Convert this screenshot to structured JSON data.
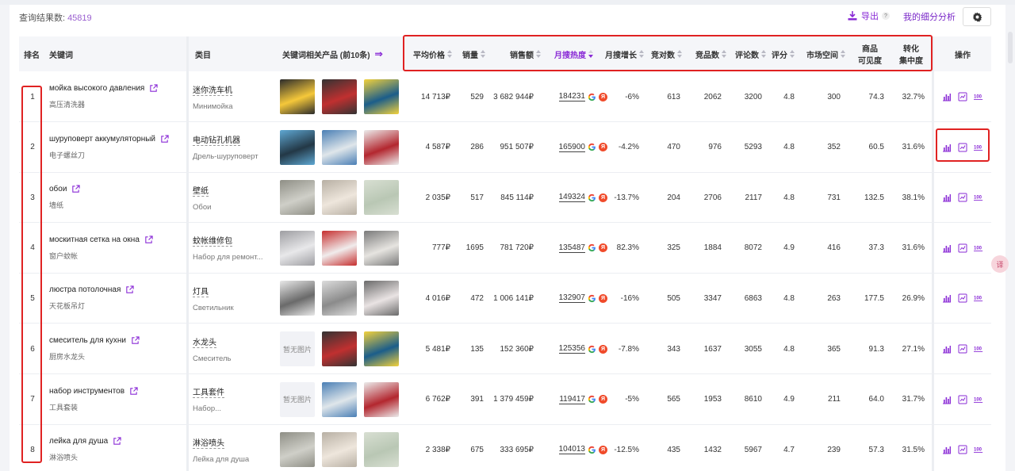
{
  "summary": {
    "label": "查询结果数:",
    "count": "45819"
  },
  "toolbar": {
    "export_label": "导出",
    "help_label": "?",
    "my_analysis_label": "我的细分分析"
  },
  "colors": {
    "accent": "#8a2bd6",
    "highlight_box": "#e02222"
  },
  "table": {
    "headers": {
      "rank": "排名",
      "keyword": "关键词",
      "category": "类目",
      "products": "关键词相关产品 (前10条)",
      "products_more": "⇒",
      "avg_price": "平均价格",
      "sales": "销量",
      "revenue": "销售额",
      "monthly_heat": "月搜热度",
      "monthly_growth": "月搜增长",
      "competition": "竞对数",
      "product_count": "竞品数",
      "reviews": "评论数",
      "rating": "评分",
      "market_space": "市场空间",
      "visibility_1": "商品",
      "visibility_2": "可见度",
      "conversion_1": "转化",
      "conversion_2": "集中度",
      "actions": "操作"
    },
    "rows": [
      {
        "rank": "1",
        "kw_ru": "мойка высокого давления",
        "kw_zh": "高压清洗器",
        "cat_zh": "迷你洗车机",
        "cat_ru": "Минимойка",
        "thumbs": [
          "img",
          "img",
          "img"
        ],
        "price": "14 713₽",
        "sales": "529",
        "revenue": "3 682 944₽",
        "heat": "184231",
        "growth": "-6%",
        "competition": "613",
        "products": "2062",
        "reviews": "3200",
        "rating": "4.8",
        "market": "300",
        "visibility": "74.3",
        "conversion": "32.7%"
      },
      {
        "rank": "2",
        "kw_ru": "шуруповерт аккумуляторный",
        "kw_zh": "电子螺丝刀",
        "cat_zh": "电动钻孔机器",
        "cat_ru": "Дрель-шуруповерт",
        "thumbs": [
          "img",
          "img",
          "img"
        ],
        "price": "4 587₽",
        "sales": "286",
        "revenue": "951 507₽",
        "heat": "165900",
        "growth": "-4.2%",
        "competition": "470",
        "products": "976",
        "reviews": "5293",
        "rating": "4.8",
        "market": "352",
        "visibility": "60.5",
        "conversion": "31.6%"
      },
      {
        "rank": "3",
        "kw_ru": "обои",
        "kw_zh": "墙纸",
        "cat_zh": "壁纸",
        "cat_ru": "Обои",
        "thumbs": [
          "img",
          "img",
          "img"
        ],
        "price": "2 035₽",
        "sales": "517",
        "revenue": "845 114₽",
        "heat": "149324",
        "growth": "-13.7%",
        "competition": "204",
        "products": "2706",
        "reviews": "2117",
        "rating": "4.8",
        "market": "731",
        "visibility": "132.5",
        "conversion": "38.1%"
      },
      {
        "rank": "4",
        "kw_ru": "москитная сетка на окна",
        "kw_zh": "窗户蚊帐",
        "cat_zh": "蚊帐维修包",
        "cat_ru": "Набор для ремонт...",
        "thumbs": [
          "img",
          "img",
          "img"
        ],
        "price": "777₽",
        "sales": "1695",
        "revenue": "781 720₽",
        "heat": "135487",
        "growth": "82.3%",
        "competition": "325",
        "products": "1884",
        "reviews": "8072",
        "rating": "4.9",
        "market": "416",
        "visibility": "37.3",
        "conversion": "31.6%"
      },
      {
        "rank": "5",
        "kw_ru": "люстра потолочная",
        "kw_zh": "天花板吊灯",
        "cat_zh": "灯具",
        "cat_ru": "Светильник",
        "thumbs": [
          "img",
          "img",
          "img"
        ],
        "price": "4 016₽",
        "sales": "472",
        "revenue": "1 006 141₽",
        "heat": "132907",
        "growth": "-16%",
        "competition": "505",
        "products": "3347",
        "reviews": "6863",
        "rating": "4.8",
        "market": "263",
        "visibility": "177.5",
        "conversion": "26.9%"
      },
      {
        "rank": "6",
        "kw_ru": "смеситель для кухни",
        "kw_zh": "厨房水龙头",
        "cat_zh": "水龙头",
        "cat_ru": "Смеситель",
        "thumbs": [
          "暂无图片",
          "img",
          "img"
        ],
        "price": "5 481₽",
        "sales": "135",
        "revenue": "152 360₽",
        "heat": "125356",
        "growth": "-7.8%",
        "competition": "343",
        "products": "1637",
        "reviews": "3055",
        "rating": "4.8",
        "market": "365",
        "visibility": "91.3",
        "conversion": "27.1%"
      },
      {
        "rank": "7",
        "kw_ru": "набор инструментов",
        "kw_zh": "工具套装",
        "cat_zh": "工具套件",
        "cat_ru": "Набор...",
        "thumbs": [
          "暂无图片",
          "img",
          "img"
        ],
        "price": "6 762₽",
        "sales": "391",
        "revenue": "1 379 459₽",
        "heat": "119417",
        "growth": "-5%",
        "competition": "565",
        "products": "1953",
        "reviews": "8610",
        "rating": "4.9",
        "market": "211",
        "visibility": "64.0",
        "conversion": "31.7%"
      },
      {
        "rank": "8",
        "kw_ru": "лейка для душа",
        "kw_zh": "淋浴喷头",
        "cat_zh": "淋浴喷头",
        "cat_ru": "Лейка для душа",
        "thumbs": [
          "img",
          "img",
          "img"
        ],
        "price": "2 338₽",
        "sales": "675",
        "revenue": "333 695₽",
        "heat": "104013",
        "growth": "-12.5%",
        "competition": "435",
        "products": "1432",
        "reviews": "5967",
        "rating": "4.7",
        "market": "239",
        "visibility": "57.3",
        "conversion": "31.5%"
      }
    ]
  },
  "float_button": {
    "label": "译"
  }
}
